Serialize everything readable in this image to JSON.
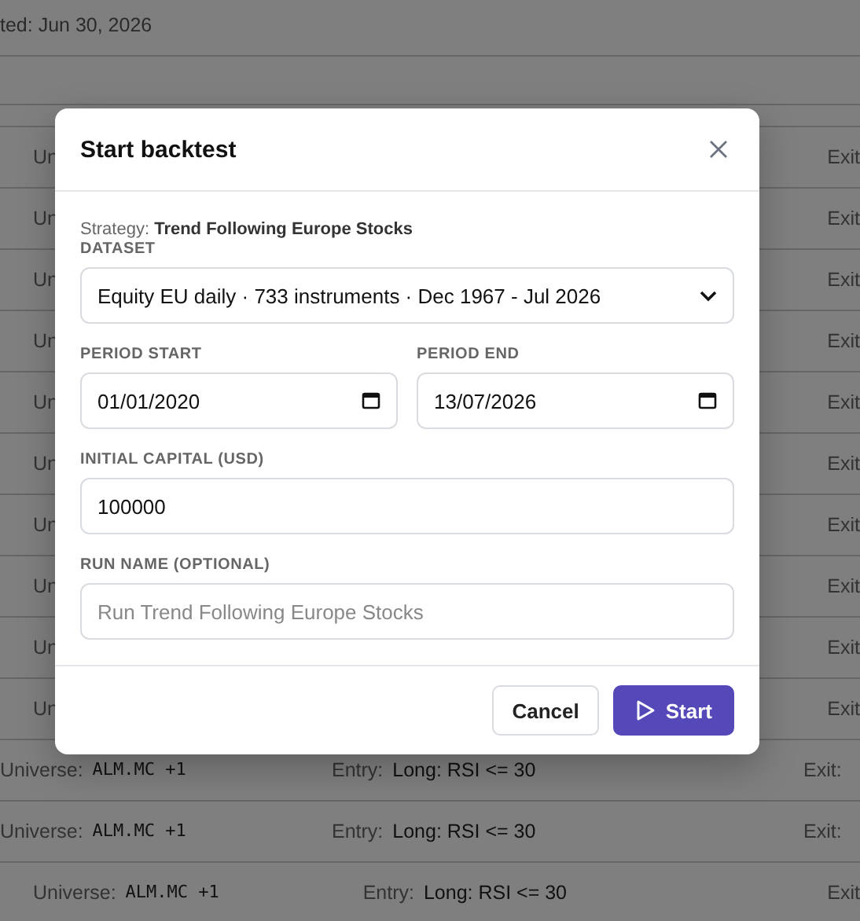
{
  "page": {
    "updated_text": "ted: Jun 30, 2026",
    "rows": [
      {
        "universe_label": "Un",
        "exit_label": "Exit"
      },
      {
        "universe_label": "Un",
        "exit_label": "Exit"
      },
      {
        "universe_label": "Un",
        "exit_label": "Exit"
      },
      {
        "universe_label": "Un",
        "exit_label": "Exit"
      },
      {
        "universe_label": "Un",
        "exit_label": "Exit"
      },
      {
        "universe_label": "Un",
        "exit_label": "Exit"
      },
      {
        "universe_label": "Un",
        "exit_label": "Exit"
      },
      {
        "universe_label": "Un",
        "exit_label": "Exit"
      },
      {
        "universe_label": "Un",
        "exit_label": "Exit"
      },
      {
        "universe_label": "Un",
        "exit_label": "Exit"
      },
      {
        "universe_label": "Universe:",
        "universe_value": "ALM.MC +1",
        "entry_label": "Entry:",
        "entry_value": "Long: RSI <= 30",
        "exit_label": "Exit:"
      },
      {
        "universe_label": "Universe:",
        "universe_value": "ALM.MC +1",
        "entry_label": "Entry:",
        "entry_value": "Long: RSI <= 30",
        "exit_label": "Exit:"
      },
      {
        "universe_label": "Universe:",
        "universe_value": "ALM.MC +1",
        "entry_label": "Entry:",
        "entry_value": "Long: RSI <= 30",
        "exit_label": "Exit"
      }
    ]
  },
  "dialog": {
    "title": "Start backtest",
    "strategy": "Strategy: **Trend Following Europe Stocks**",
    "dataset": {
      "label": "DATASET",
      "value": "Equity EU daily · 733 instruments · Dec 1967 - Jul 2026"
    },
    "period_start": {
      "label": "PERIOD START",
      "value": "01/01/2020"
    },
    "period_end": {
      "label": "PERIOD END",
      "value": "13/07/2026"
    },
    "initial_capital": {
      "label": "INITIAL CAPITAL (USD)",
      "value": "100000"
    },
    "run_name": {
      "label": "RUN NAME (OPTIONAL)",
      "placeholder": "Run Trend Following Europe Stocks"
    },
    "buttons": {
      "cancel": "Cancel",
      "start": "Start"
    }
  }
}
